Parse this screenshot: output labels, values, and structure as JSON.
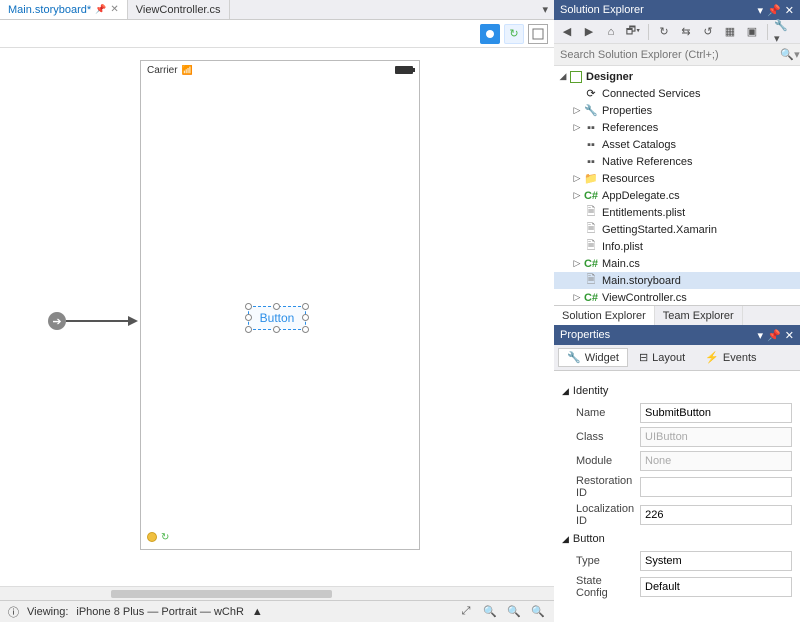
{
  "tabs": {
    "items": [
      {
        "label": "Main.storyboard*",
        "active": true,
        "pinned": true
      },
      {
        "label": "ViewController.cs",
        "active": false,
        "pinned": false
      }
    ]
  },
  "device": {
    "carrier": "Carrier",
    "button_label": "Button"
  },
  "statusbar": {
    "viewing_prefix": "Viewing:",
    "device": "iPhone 8 Plus — Portrait — wChR"
  },
  "solution_explorer": {
    "title": "Solution Explorer",
    "search_placeholder": "Search Solution Explorer (Ctrl+;)",
    "tree": {
      "root": "Designer",
      "items": [
        {
          "label": "Connected Services",
          "exp": "",
          "icon": "cloud"
        },
        {
          "label": "Properties",
          "exp": "▷",
          "icon": "prop"
        },
        {
          "label": "References",
          "exp": "▷",
          "icon": "ref"
        },
        {
          "label": "Asset Catalogs",
          "exp": "",
          "icon": "ref"
        },
        {
          "label": "Native References",
          "exp": "",
          "icon": "ref"
        },
        {
          "label": "Resources",
          "exp": "▷",
          "icon": "folder"
        },
        {
          "label": "AppDelegate.cs",
          "exp": "▷",
          "icon": "cs"
        },
        {
          "label": "Entitlements.plist",
          "exp": "",
          "icon": "doc"
        },
        {
          "label": "GettingStarted.Xamarin",
          "exp": "",
          "icon": "doc"
        },
        {
          "label": "Info.plist",
          "exp": "",
          "icon": "doc"
        },
        {
          "label": "Main.cs",
          "exp": "▷",
          "icon": "cs"
        },
        {
          "label": "Main.storyboard",
          "exp": "",
          "icon": "doc",
          "selected": true
        },
        {
          "label": "ViewController.cs",
          "exp": "▷",
          "icon": "cs"
        }
      ]
    },
    "bottom_tabs": {
      "active": "Solution Explorer",
      "other": "Team Explorer"
    }
  },
  "properties": {
    "title": "Properties",
    "tabs": {
      "widget": "Widget",
      "layout": "Layout",
      "events": "Events"
    },
    "sections": {
      "identity": {
        "header": "Identity",
        "name_label": "Name",
        "name_value": "SubmitButton",
        "class_label": "Class",
        "class_value": "UIButton",
        "module_label": "Module",
        "module_value": "None",
        "restoration_label": "Restoration ID",
        "restoration_value": "",
        "localization_label": "Localization ID",
        "localization_value": "226"
      },
      "button": {
        "header": "Button",
        "type_label": "Type",
        "type_value": "System",
        "state_label": "State Config",
        "state_value": "Default"
      }
    }
  }
}
